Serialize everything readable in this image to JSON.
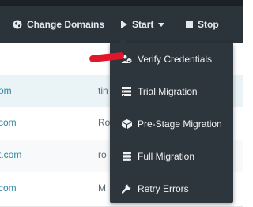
{
  "toolbar": {
    "change_domains": "Change Domains",
    "start": "Start",
    "stop": "Stop"
  },
  "table": {
    "rows": [
      {
        "c1": "",
        "c2": ""
      },
      {
        "c1": "om",
        "c2": "tin"
      },
      {
        "c1": "com",
        "c2": "Ro"
      },
      {
        "c1": "t.com",
        "c2": "ro"
      },
      {
        "c1": "com",
        "c2": "M"
      }
    ]
  },
  "start_menu": {
    "items": [
      {
        "label": "Verify Credentials",
        "icon": "users-check-icon"
      },
      {
        "label": "Trial Migration",
        "icon": "list-icon"
      },
      {
        "label": "Pre-Stage Migration",
        "icon": "cube-icon"
      },
      {
        "label": "Full Migration",
        "icon": "database-icon"
      },
      {
        "label": "Retry Errors",
        "icon": "wrench-icon"
      }
    ]
  },
  "colors": {
    "toolbar_bg": "#2b333b",
    "menu_bg": "#2d353d",
    "link_teal": "#2f88a3",
    "annotation_red": "#e2162b"
  }
}
